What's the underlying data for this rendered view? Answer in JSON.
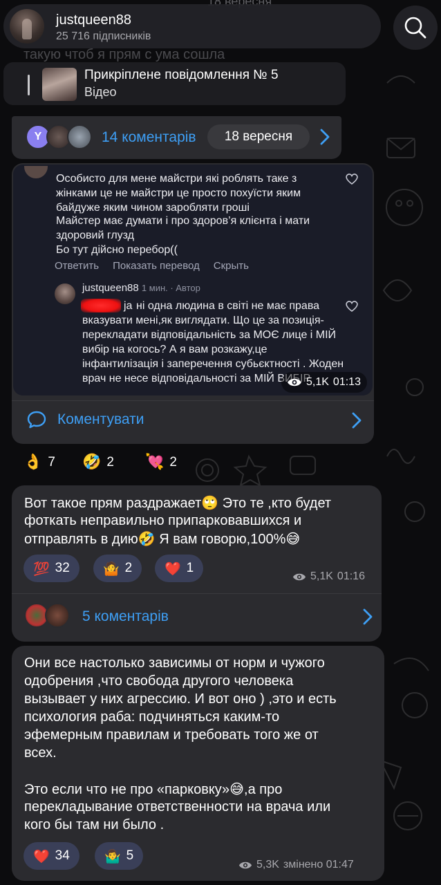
{
  "header": {
    "channel_name": "justqueen88",
    "subscribers": "25 716 підписників",
    "bg_date": "18 вересня",
    "bg_text": "такую чтоб я прям с ума сошла"
  },
  "pinned": {
    "title": "Прикріплене повідомлення № 5",
    "subtitle": "Відео"
  },
  "comments_bar": {
    "avatar_letter": "Y",
    "label": "14 коментарів",
    "date": "18 вересня"
  },
  "video_post": {
    "comment": {
      "paragraph1": "Особисто для мене майстри які роблять таке з жінками це не майстри це просто похуїсти яким байдуже яким чином заробляти гроші",
      "paragraph2": "Майстер має думати і про здоров’я клієнта і мати здоровий глузд",
      "paragraph3": "Бо тут дійсно перебор((",
      "actions": [
        "Ответить",
        "Показать перевод",
        "Скрыть"
      ]
    },
    "reply": {
      "author": "justqueen88",
      "time_meta": "1 мин. · Автор",
      "partial_name": "ja",
      "text": "ні одна людина в світі не має права вказувати мені,як виглядати. Що це за позиція- перекладати відповідальність за МОЄ лице і МІЙ вибір на когось? А я вам розкажу,це інфантилізація і заперечення субьєктності . Жоден врач не несе відповідальності за МІЙ ВИБІР"
    },
    "views": "5,1K",
    "time": "01:13",
    "comment_action": "Коментувати",
    "reactions": [
      {
        "emoji": "👌",
        "count": "7"
      },
      {
        "emoji": "🤣",
        "count": "2"
      },
      {
        "emoji": "💘",
        "count": "2"
      }
    ]
  },
  "post2": {
    "text_line1": "Вот такое прям раздражает",
    "text_line1_rest": " Это те ,кто будет",
    "text_line2": "фоткать неправильно припарковавшихся и",
    "text_line3": "отправлять в дию",
    "text_line3_rest": " Я вам говорю,100%",
    "reactions": [
      {
        "emoji": "💯",
        "count": "32"
      },
      {
        "emoji": "🤷",
        "count": "2"
      },
      {
        "emoji": "❤️",
        "count": "1"
      }
    ],
    "views": "5,1K",
    "time": "01:16",
    "comments_label": "5 коментарів"
  },
  "post3": {
    "lines": [
      "Они все настолько зависимы от норм и чужого",
      "одобрения ,что свобода другого человека",
      "вызывает у них агрессию. И вот оно ) ,это и есть",
      "психология раба: подчиняться каким-то",
      "эфемерным правилам и требовать того же от",
      "всех."
    ],
    "lines2_a": "Это если что не про «парковку»",
    "lines2_a_rest": ",а про",
    "lines2_b": "перекладывание ответственности на врача или",
    "lines2_c": "кого бы там ни было .",
    "reactions": [
      {
        "emoji": "❤️",
        "count": "34"
      },
      {
        "emoji": "🤷‍♂️",
        "count": "5"
      }
    ],
    "views": "5,3K",
    "edited_time": "змінено 01:47"
  },
  "colors": {
    "accent": "#3e9ff5",
    "bubble": "#2b2b2f",
    "reaction_chip": "#3a3f58",
    "background": "#0c0c0e"
  }
}
